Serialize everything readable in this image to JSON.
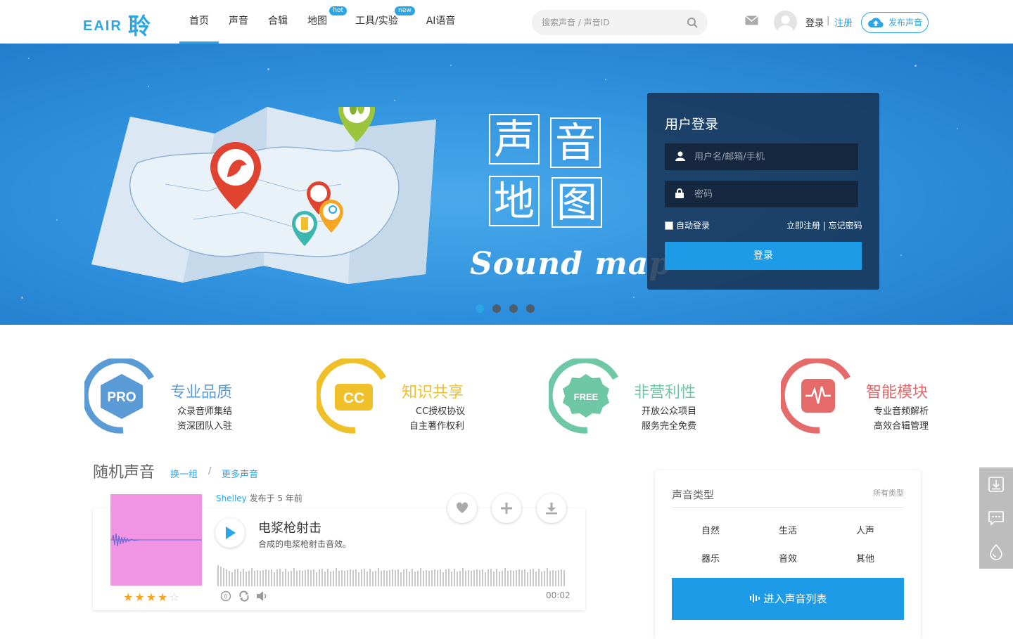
{
  "header": {
    "logo_latin": "EAIR",
    "logo_cjk": "聆",
    "nav": [
      {
        "label": "首页",
        "active": true,
        "badge": ""
      },
      {
        "label": "声音",
        "active": false,
        "badge": ""
      },
      {
        "label": "合辑",
        "active": false,
        "badge": ""
      },
      {
        "label": "地图",
        "active": false,
        "badge": "hot"
      },
      {
        "label": "工具/实验",
        "active": false,
        "badge": "new"
      },
      {
        "label": "AI语音",
        "active": false,
        "badge": ""
      }
    ],
    "search_placeholder": "搜索声音 / 声音ID",
    "login": "登录",
    "separator": "|",
    "register": "注册",
    "publish": "发布声音"
  },
  "banner": {
    "title_chars": [
      "声",
      "音",
      "地",
      "图"
    ],
    "subtitle": "Sound map",
    "slides": 4,
    "active_slide": 0
  },
  "login_panel": {
    "title": "用户登录",
    "username_placeholder": "用户名/邮箱/手机",
    "password_placeholder": "密码",
    "remember": "自动登录",
    "links": "立即注册 | 忘记密码",
    "submit": "登录"
  },
  "features": [
    {
      "badge": "PRO",
      "title": "专业品质",
      "line1": "众录音师集结",
      "line2": "资深团队入驻",
      "color": "#5b9bd5"
    },
    {
      "badge": "CC",
      "title": "知识共享",
      "line1": "CC授权协议",
      "line2": "自主著作权利",
      "color": "#f0c02a"
    },
    {
      "badge": "FREE",
      "title": "非营利性",
      "line1": "开放公众项目",
      "line2": "服务完全免费",
      "color": "#6fc8a5"
    },
    {
      "badge": "",
      "title": "智能模块",
      "line1": "专业音频解析",
      "line2": "高效合辑管理",
      "color": "#e56a6a"
    }
  ],
  "random": {
    "title": "随机声音",
    "refresh": "换一组",
    "slash": "/",
    "more": "更多声音",
    "sound": {
      "author": "Shelley",
      "posted": "发布于 5 年前",
      "name": "电浆枪射击",
      "description": "合成的电浆枪射击音效。",
      "rating": 4,
      "rating_max": 5,
      "duration": "00:02"
    }
  },
  "types": {
    "title": "声音类型",
    "all": "所有类型",
    "items": [
      "自然",
      "生活",
      "人声",
      "器乐",
      "音效",
      "其他"
    ],
    "enter": "进入声音列表"
  },
  "colors": {
    "accent": "#2aa6e6",
    "button": "#1e9be6"
  }
}
